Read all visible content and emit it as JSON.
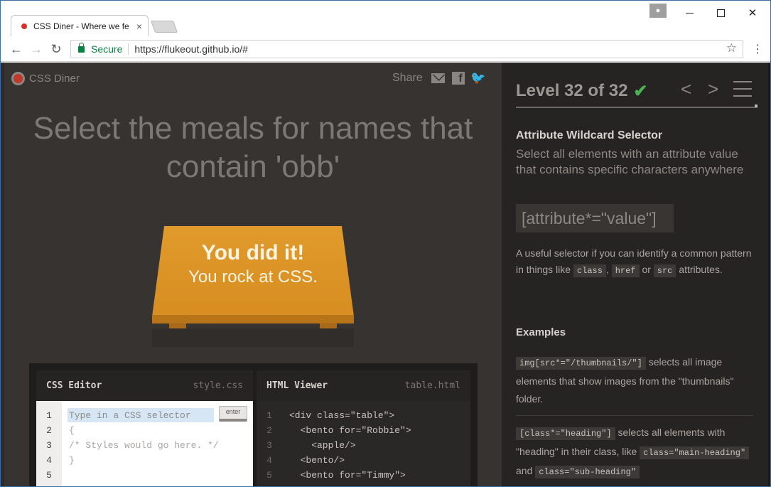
{
  "browser": {
    "tab_title": "CSS Diner - Where we fe",
    "tab_close": "×",
    "url": "https://flukeout.github.io/#",
    "secure_label": "Secure",
    "back": "←",
    "forward": "→",
    "reload": "↻",
    "star": "☆",
    "menu": "⋮",
    "window_close": "✕"
  },
  "game": {
    "logo": "CSS Diner",
    "share_label": "Share",
    "share_twitter": "🐦",
    "facebook": "f",
    "instruction": "Select the meals for names that contain 'obb'",
    "win_line1": "You did it!",
    "win_line2": "You rock at CSS."
  },
  "editor": {
    "css_title": "CSS Editor",
    "css_file": "style.css",
    "html_title": "HTML Viewer",
    "html_file": "table.html",
    "placeholder": "Type in a CSS selector",
    "enter": "enter",
    "line_numbers": "1\n2\n3\n4\n5",
    "css_code": "\n{\n/* Styles would go here. */\n}",
    "html_code": "<div class=\"table\">\n  <bento for=\"Robbie\">\n    <apple/>\n  <bento/>\n  <bento for=\"Timmy\">"
  },
  "sidebar": {
    "level": "Level 32 of 32",
    "check": "✔",
    "prev": "<",
    "next": ">",
    "selector_name": "Attribute Wildcard Selector",
    "selector_desc": "Select all elements with an attribute value that contains specific characters anywhere",
    "syntax": "[attribute*=\"value\"]",
    "hint_pre": "A useful selector if you can identify a common pattern in things like",
    "hint_tag1": "class",
    "hint_comma": ",",
    "hint_tag2": "href",
    "hint_or": "or",
    "hint_tag3": "src",
    "hint_post": "attributes.",
    "examples_heading": "Examples",
    "ex1_code": "img[src*=\"/thumbnails/\"]",
    "ex1_text": "selects all image elements that show images from the \"thumbnails\" folder.",
    "ex2_code": "[class*=\"heading\"]",
    "ex2_text": "selects all elements with \"heading\" in their class, like",
    "ex2_tag1": "class=\"main-heading\"",
    "ex2_and": "and",
    "ex2_tag2": "class=\"sub-heading\""
  },
  "colors": {
    "accent": "#e19a2c",
    "secure_green": "#0b8043",
    "check_green": "#4caf50"
  }
}
